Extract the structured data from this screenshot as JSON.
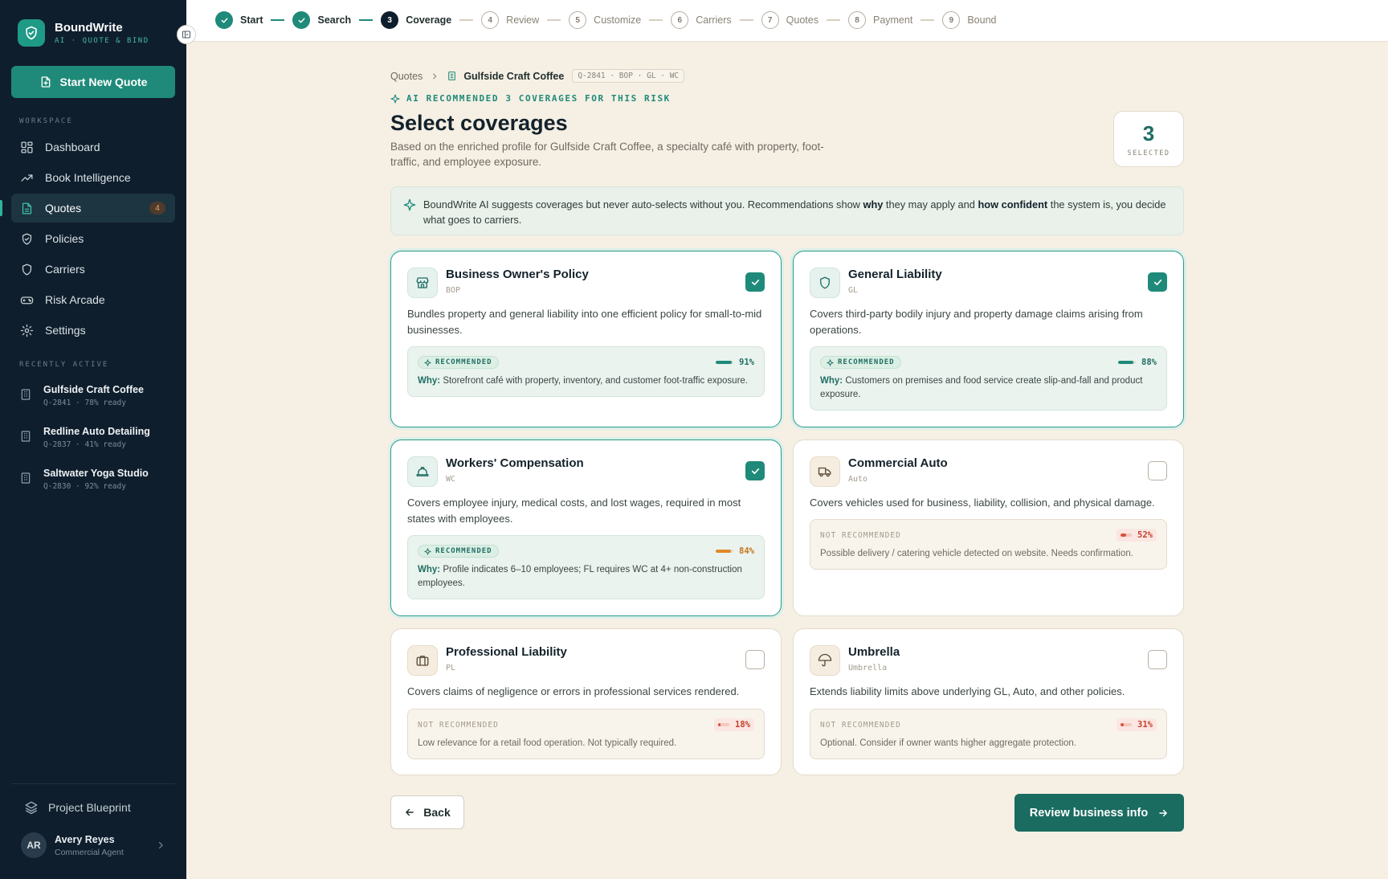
{
  "brand": {
    "name": "BoundWrite",
    "tagline": "AI · QUOTE & BIND"
  },
  "sidebar": {
    "new_quote_label": "Start New Quote",
    "workspace_label": "WORKSPACE",
    "nav": [
      {
        "label": "Dashboard",
        "icon": "dashboard-icon"
      },
      {
        "label": "Book Intelligence",
        "icon": "trend-icon"
      },
      {
        "label": "Quotes",
        "icon": "document-icon",
        "badge": "4",
        "active": true
      },
      {
        "label": "Policies",
        "icon": "shield-icon"
      },
      {
        "label": "Carriers",
        "icon": "shield-icon"
      },
      {
        "label": "Risk Arcade",
        "icon": "gamepad-icon"
      },
      {
        "label": "Settings",
        "icon": "gear-icon"
      }
    ],
    "recent_label": "RECENTLY ACTIVE",
    "recent": [
      {
        "name": "Gulfside Craft Coffee",
        "meta": "Q-2841 · 78% ready"
      },
      {
        "name": "Redline Auto Detailing",
        "meta": "Q-2837 · 41% ready"
      },
      {
        "name": "Saltwater Yoga Studio",
        "meta": "Q-2830 · 92% ready"
      }
    ],
    "blueprint_label": "Project Blueprint",
    "user": {
      "initials": "AR",
      "name": "Avery Reyes",
      "role": "Commercial Agent"
    }
  },
  "stepper": {
    "steps": [
      {
        "label": "Start",
        "state": "done"
      },
      {
        "label": "Search",
        "state": "done"
      },
      {
        "num": "3",
        "label": "Coverage",
        "state": "current"
      },
      {
        "num": "4",
        "label": "Review",
        "state": "todo"
      },
      {
        "num": "5",
        "label": "Customize",
        "state": "todo"
      },
      {
        "num": "6",
        "label": "Carriers",
        "state": "todo"
      },
      {
        "num": "7",
        "label": "Quotes",
        "state": "todo"
      },
      {
        "num": "8",
        "label": "Payment",
        "state": "todo"
      },
      {
        "num": "9",
        "label": "Bound",
        "state": "todo"
      }
    ]
  },
  "breadcrumb": {
    "root": "Quotes",
    "current": "Gulfside Craft Coffee",
    "ref": "Q-2841 · BOP · GL · WC"
  },
  "header": {
    "eyebrow": "AI RECOMMENDED 3 COVERAGES FOR THIS RISK",
    "title": "Select coverages",
    "subtitle": "Based on the enriched profile for Gulfside Craft Coffee, a specialty café with property, foot-traffic, and employee exposure.",
    "selected_count": "3",
    "selected_label": "SELECTED"
  },
  "notice": {
    "part1": "BoundWrite AI suggests coverages but never auto-selects without you. Recommendations show ",
    "bold1": "why",
    "part2": " they may apply and ",
    "bold2": "how confident",
    "part3": " the system is, you decide what goes to carriers."
  },
  "coverages": [
    {
      "title": "Business Owner's Policy",
      "code": "BOP",
      "desc": "Bundles property and general liability into one efficient policy for small-to-mid businesses.",
      "selected": true,
      "recommended": true,
      "rec_label": "RECOMMENDED",
      "confidence": 0.91,
      "confidence_label": "91%",
      "why_label": "Why:",
      "why": "Storefront café with property, inventory, and customer foot-traffic exposure.",
      "icon": "storefront-icon"
    },
    {
      "title": "General Liability",
      "code": "GL",
      "desc": "Covers third-party bodily injury and property damage claims arising from operations.",
      "selected": true,
      "recommended": true,
      "rec_label": "RECOMMENDED",
      "confidence": 0.88,
      "confidence_label": "88%",
      "why_label": "Why:",
      "why": "Customers on premises and food service create slip-and-fall and product exposure.",
      "icon": "shield-icon"
    },
    {
      "title": "Workers' Compensation",
      "code": "WC",
      "desc": "Covers employee injury, medical costs, and lost wages, required in most states with employees.",
      "selected": true,
      "recommended": true,
      "rec_label": "RECOMMENDED",
      "confidence": 0.84,
      "confidence_label": "84%",
      "why_label": "Why:",
      "why": "Profile indicates 6–10 employees; FL requires WC at 4+ non-construction employees.",
      "icon": "hardhat-icon"
    },
    {
      "title": "Commercial Auto",
      "code": "Auto",
      "desc": "Covers vehicles used for business, liability, collision, and physical damage.",
      "selected": false,
      "recommended": false,
      "rec_label": "NOT RECOMMENDED",
      "confidence": 0.52,
      "confidence_label": "52%",
      "why": "Possible delivery / catering vehicle detected on website. Needs confirmation.",
      "icon": "truck-icon"
    },
    {
      "title": "Professional Liability",
      "code": "PL",
      "desc": "Covers claims of negligence or errors in professional services rendered.",
      "selected": false,
      "recommended": false,
      "rec_label": "NOT RECOMMENDED",
      "confidence": 0.18,
      "confidence_label": "18%",
      "why": "Low relevance for a retail food operation. Not typically required.",
      "icon": "briefcase-icon"
    },
    {
      "title": "Umbrella",
      "code": "Umbrella",
      "desc": "Extends liability limits above underlying GL, Auto, and other policies.",
      "selected": false,
      "recommended": false,
      "rec_label": "NOT RECOMMENDED",
      "confidence": 0.31,
      "confidence_label": "31%",
      "why": "Optional. Consider if owner wants higher aggregate protection.",
      "icon": "umbrella-icon"
    }
  ],
  "actions": {
    "back_label": "Back",
    "next_label": "Review business info"
  },
  "colors": {
    "accent": "#1f8a79",
    "sidebar": "#0f1e2d",
    "high": "#1f8a79",
    "medium": "#e0892a",
    "low": "#d9503c"
  }
}
